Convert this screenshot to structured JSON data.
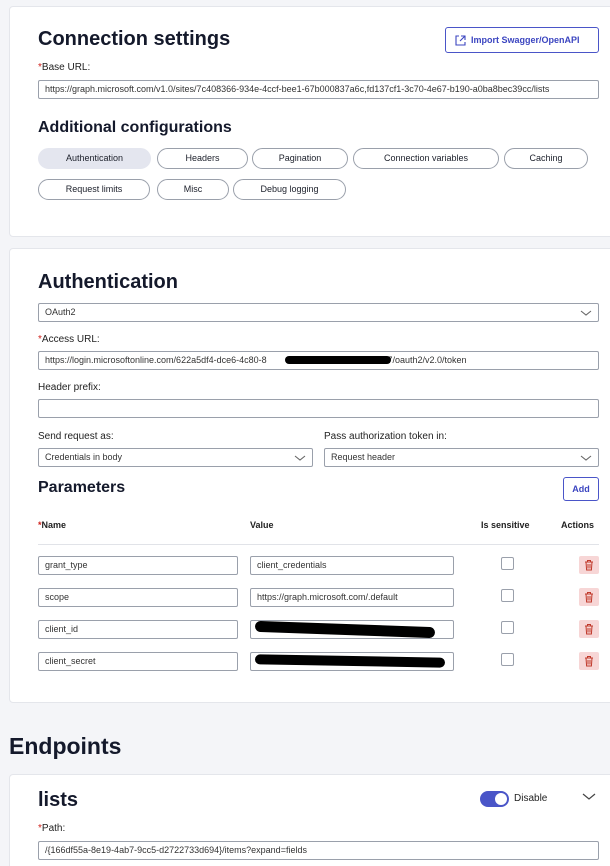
{
  "connection": {
    "title": "Connection settings",
    "import_button": "Import Swagger/OpenAPI",
    "base_url_label": "Base URL:",
    "base_url_value": "https://graph.microsoft.com/v1.0/sites/7c408366-934e-4ccf-bee1-67b000837a6c,fd137cf1-3c70-4e67-b190-a0ba8bec39cc/lists",
    "additional_title": "Additional configurations",
    "tabs": [
      "Authentication",
      "Headers",
      "Pagination",
      "Connection variables",
      "Caching",
      "Request limits",
      "Misc",
      "Debug logging"
    ]
  },
  "auth": {
    "title": "Authentication",
    "type_value": "OAuth2",
    "access_url_label": "Access URL:",
    "access_url_value": "https://login.microsoftonline.com/622a5df4-dce6-4c80-8",
    "access_url_tail": "c7/oauth2/v2.0/token",
    "header_prefix_label": "Header prefix:",
    "header_prefix_value": "",
    "send_as_label": "Send request as:",
    "send_as_value": "Credentials in body",
    "pass_token_label": "Pass authorization token in:",
    "pass_token_value": "Request header"
  },
  "parameters": {
    "title": "Parameters",
    "add_button": "Add",
    "columns": {
      "name": "Name",
      "value": "Value",
      "sensitive": "Is sensitive",
      "actions": "Actions"
    },
    "rows": [
      {
        "name": "grant_type",
        "value": "client_credentials"
      },
      {
        "name": "scope",
        "value": "https://graph.microsoft.com/.default"
      },
      {
        "name": "client_id",
        "value": ""
      },
      {
        "name": "client_secret",
        "value": ""
      }
    ]
  },
  "endpoints": {
    "title": "Endpoints",
    "endpoint_name": "lists",
    "toggle_label": "Disable",
    "path_label": "Path:",
    "path_value": "/{166df55a-8e19-4ab7-9cc5-d2722733d694}/items?expand=fields"
  },
  "colors": {
    "accent": "#4a55c8",
    "required": "#d0221c",
    "danger_bg": "#f7d6d6"
  }
}
